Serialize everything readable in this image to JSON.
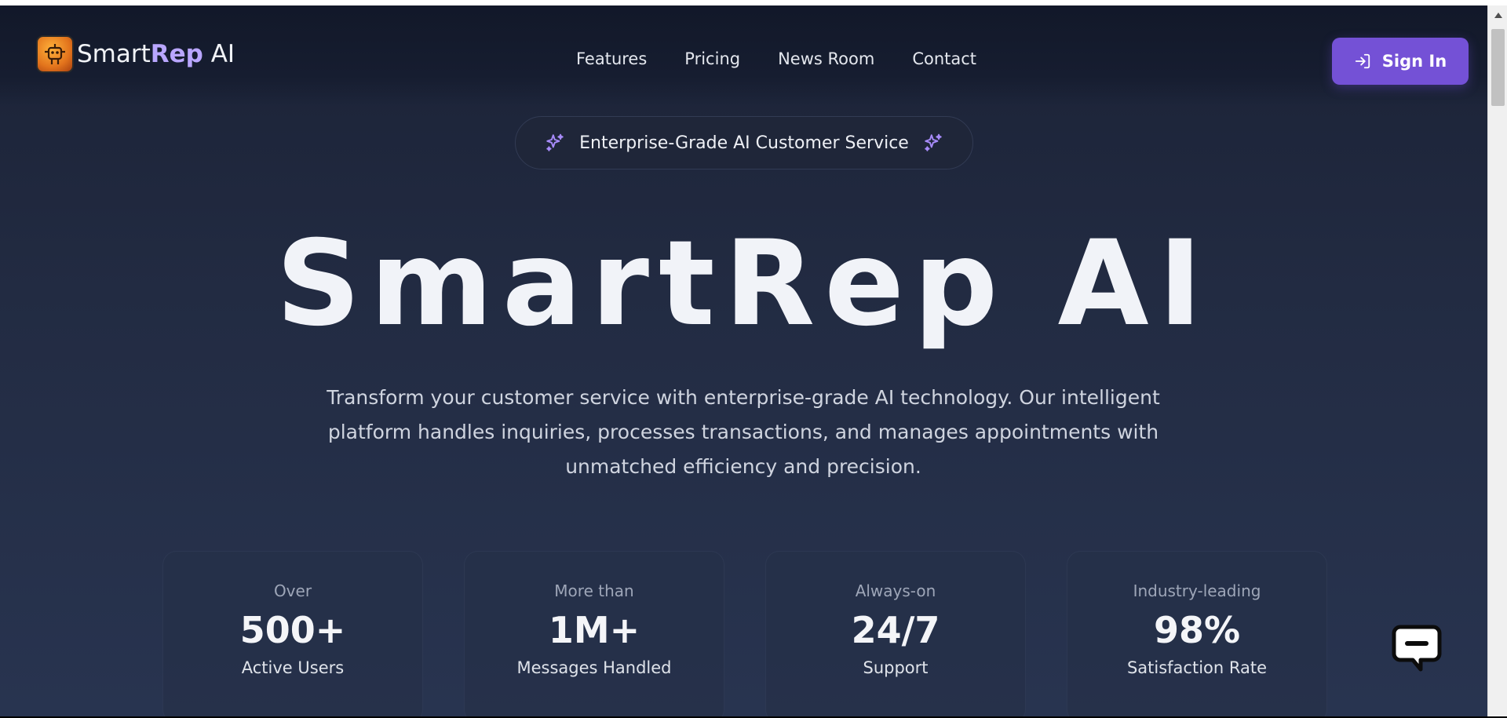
{
  "brand": {
    "name_part1": "Smart",
    "name_part2": "Rep",
    "name_part3": " AI",
    "logo_icon": "robot-chip-icon"
  },
  "nav": {
    "links": [
      "Features",
      "Pricing",
      "News Room",
      "Contact"
    ],
    "signin_label": "Sign In",
    "signin_icon": "sign-in-arrow-icon"
  },
  "badge": {
    "text": "Enterprise-Grade AI Customer Service",
    "icon": "sparkle-icon"
  },
  "hero": {
    "title": "SmartRep AI",
    "description": "Transform your customer service with enterprise-grade AI technology. Our intelligent platform handles inquiries, processes transactions, and manages appointments with unmatched efficiency and precision."
  },
  "stats": [
    {
      "prefix": "Over",
      "value": "500+",
      "label": "Active Users"
    },
    {
      "prefix": "More than",
      "value": "1M+",
      "label": "Messages Handled"
    },
    {
      "prefix": "Always-on",
      "value": "24/7",
      "label": "Support"
    },
    {
      "prefix": "Industry-leading",
      "value": "98%",
      "label": "Satisfaction Rate"
    }
  ],
  "chat_widget": {
    "icon": "chat-bubble-icon"
  },
  "colors": {
    "accent": "#7451d6",
    "brand_highlight": "#b9a6ff",
    "background": "#1b2236",
    "sparkle": "#a78bfa"
  }
}
